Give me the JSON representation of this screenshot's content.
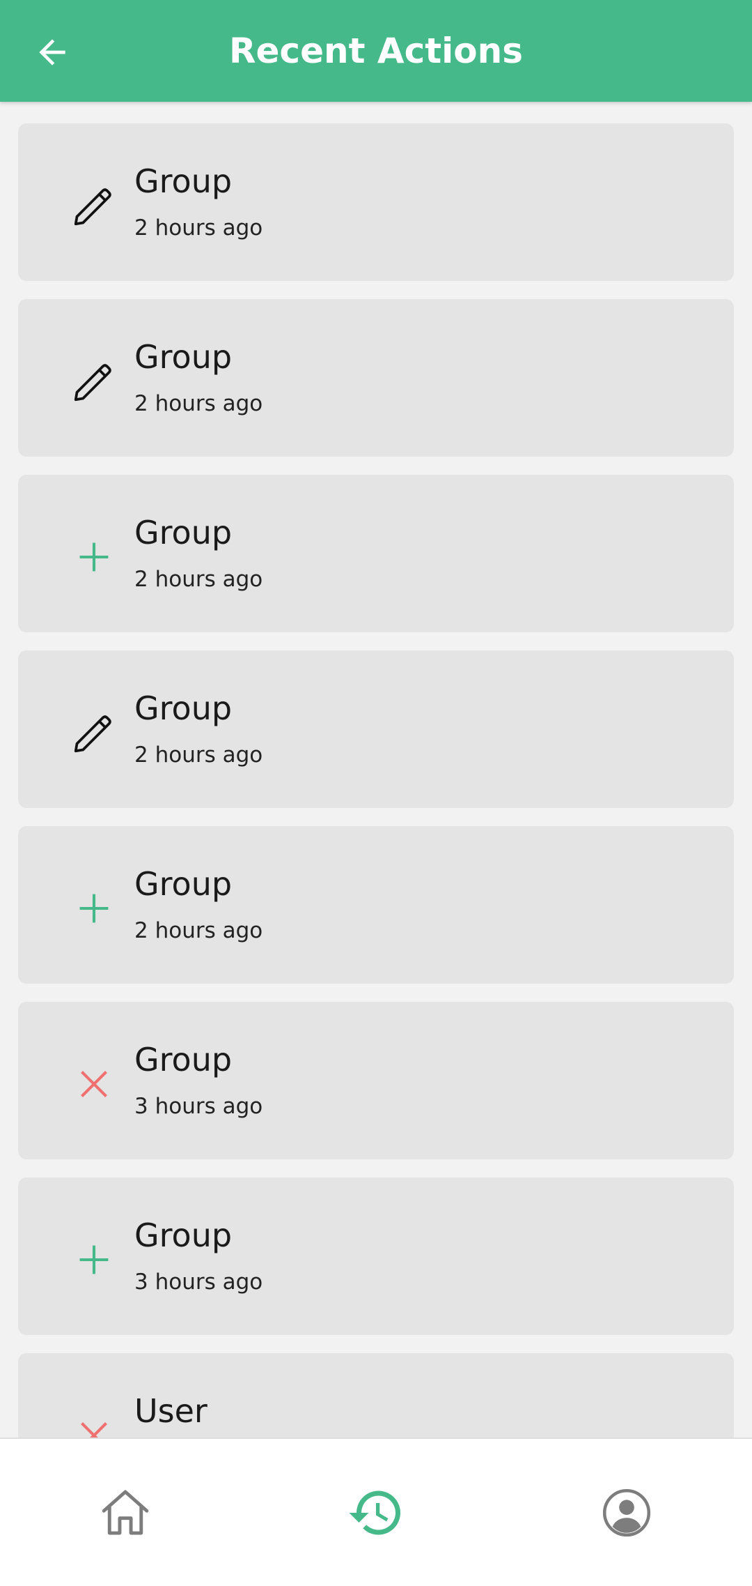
{
  "header": {
    "title": "Recent Actions",
    "back_icon": "arrow-left-icon"
  },
  "colors": {
    "primary": "#46b98a",
    "add": "#46b98a",
    "delete": "#f07070",
    "edit": "#111111",
    "card": "#e4e4e4",
    "background": "#f2f2f2",
    "nav_inactive": "#7d7d7d"
  },
  "actions": [
    {
      "type": "edit",
      "icon": "pencil-icon",
      "title": "Group",
      "time": "2 hours ago"
    },
    {
      "type": "edit",
      "icon": "pencil-icon",
      "title": "Group",
      "time": "2 hours ago"
    },
    {
      "type": "add",
      "icon": "plus-icon",
      "title": "Group",
      "time": "2 hours ago"
    },
    {
      "type": "edit",
      "icon": "pencil-icon",
      "title": "Group",
      "time": "2 hours ago"
    },
    {
      "type": "add",
      "icon": "plus-icon",
      "title": "Group",
      "time": "2 hours ago"
    },
    {
      "type": "delete",
      "icon": "close-icon",
      "title": "Group",
      "time": "3 hours ago"
    },
    {
      "type": "add",
      "icon": "plus-icon",
      "title": "Group",
      "time": "3 hours ago"
    },
    {
      "type": "delete",
      "icon": "close-icon",
      "title": "User",
      "time": ""
    }
  ],
  "bottom_nav": {
    "items": [
      {
        "name": "home",
        "icon": "home-icon",
        "active": false
      },
      {
        "name": "recent-actions",
        "icon": "history-icon",
        "active": true
      },
      {
        "name": "profile",
        "icon": "account-circle-icon",
        "active": false
      }
    ]
  }
}
